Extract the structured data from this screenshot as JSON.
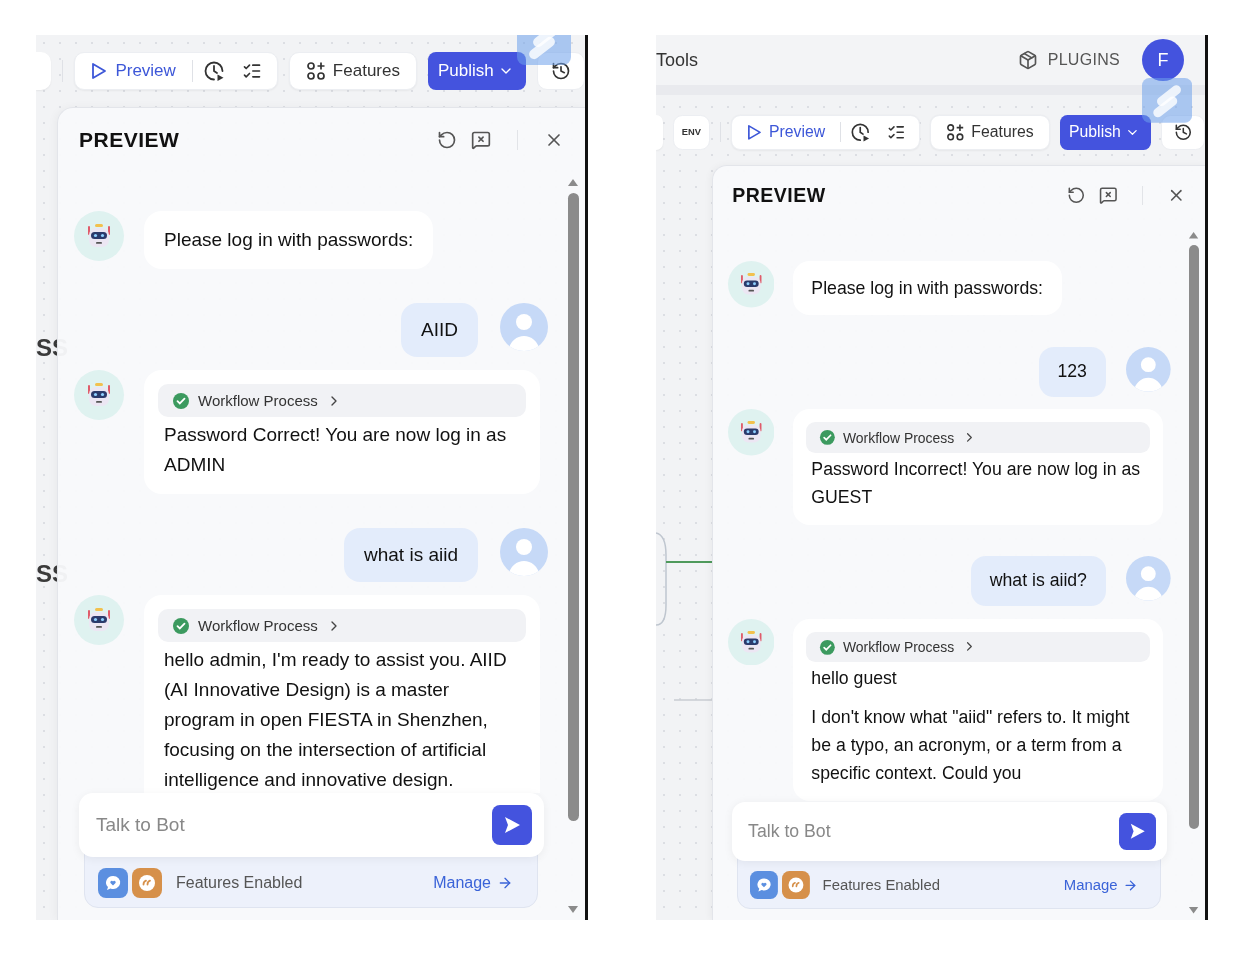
{
  "screens": [
    {
      "canvas_labels": [
        "SS",
        "SS"
      ],
      "toolbar": {
        "preview": "Preview",
        "features": "Features",
        "publish": "Publish"
      },
      "panel": {
        "title": "PREVIEW",
        "messages": [
          {
            "kind": "bot",
            "paragraphs": [
              "Please log in with passwords:"
            ]
          },
          {
            "kind": "user",
            "paragraphs": [
              "AIID"
            ]
          },
          {
            "kind": "bot",
            "workflow": "Workflow Process",
            "paragraphs": [
              "Password Correct! You are now log in as ADMIN"
            ]
          },
          {
            "kind": "user",
            "paragraphs": [
              "what is aiid"
            ]
          },
          {
            "kind": "bot",
            "workflow": "Workflow Process",
            "paragraphs": [
              "hello admin, I'm ready to assist you. AIID (AI Innovative Design) is a master program in open FIESTA in Shenzhen, focusing on the intersection of artificial intelligence and innovative design."
            ]
          }
        ],
        "input": {
          "placeholder": "Talk to Bot"
        },
        "features": {
          "label": "Features Enabled",
          "link": "Manage"
        }
      }
    },
    {
      "top_bar": {
        "title": "Tools",
        "plugins": "PLUGINS",
        "avatar": "F"
      },
      "toolbar": {
        "env": "ENV",
        "preview": "Preview",
        "features": "Features",
        "publish": "Publish"
      },
      "panel": {
        "title": "PREVIEW",
        "messages": [
          {
            "kind": "bot",
            "paragraphs": [
              "Please log in with passwords:"
            ]
          },
          {
            "kind": "user",
            "paragraphs": [
              "123"
            ]
          },
          {
            "kind": "bot",
            "workflow": "Workflow Process",
            "paragraphs": [
              "Password Incorrect! You are now log in as GUEST"
            ]
          },
          {
            "kind": "user",
            "paragraphs": [
              "what is aiid?"
            ]
          },
          {
            "kind": "bot",
            "workflow": "Workflow Process",
            "paragraphs": [
              "hello guest",
              "I don't know what \"aiid\" refers to. It might be a typo, an acronym, or a term from a specific context. Could you"
            ]
          }
        ],
        "input": {
          "placeholder": "Talk to Bot"
        },
        "features": {
          "label": "Features Enabled",
          "link": "Manage"
        }
      }
    }
  ]
}
